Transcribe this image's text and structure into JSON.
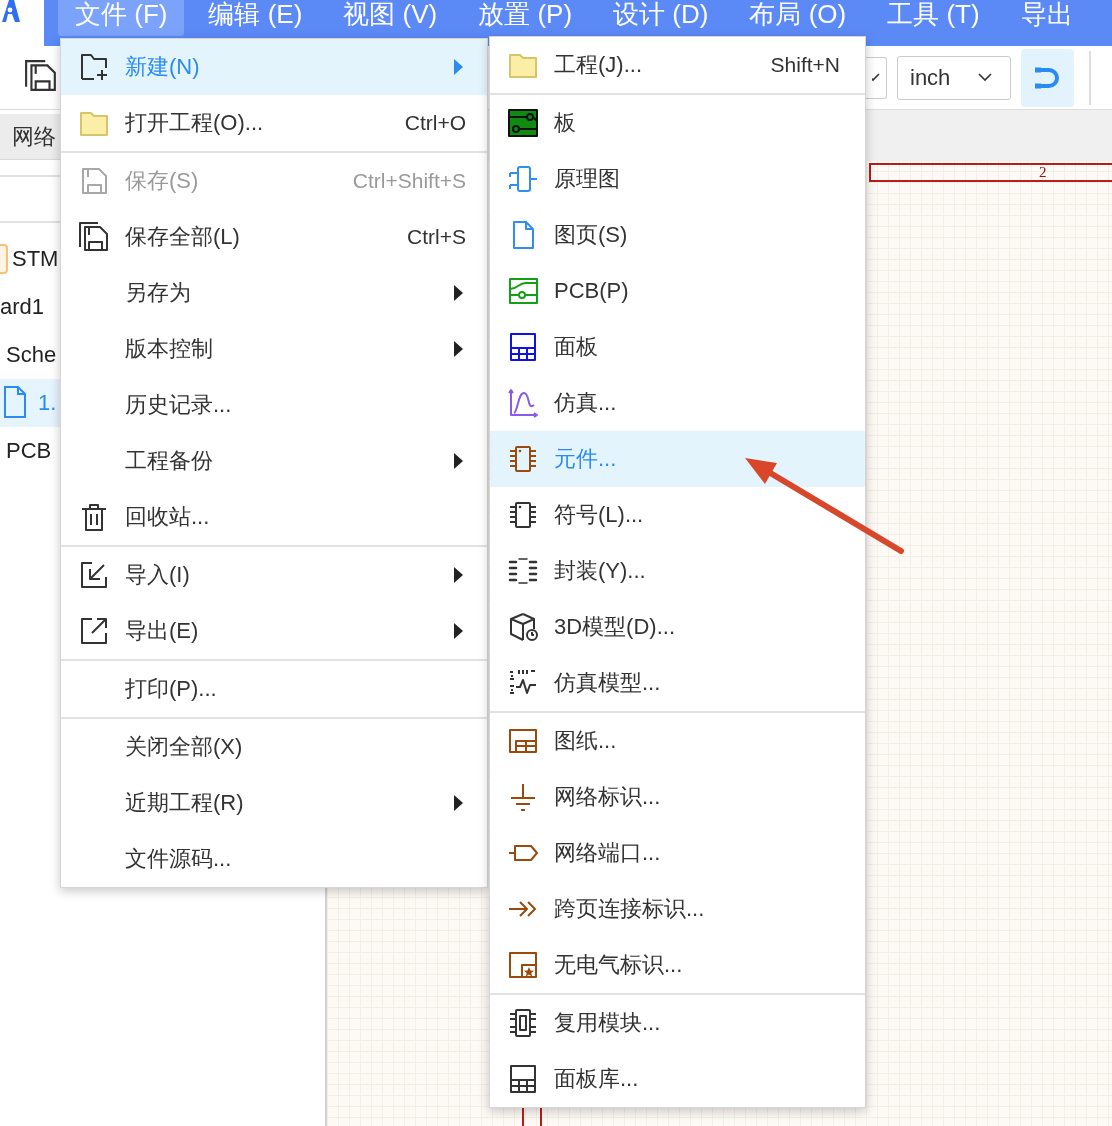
{
  "menubar": {
    "items": [
      {
        "label": "文件 (F)",
        "selected": true
      },
      {
        "label": "编辑 (E)",
        "selected": false
      },
      {
        "label": "视图 (V)",
        "selected": false
      },
      {
        "label": "放置 (P)",
        "selected": false
      },
      {
        "label": "设计 (D)",
        "selected": false
      },
      {
        "label": "布局 (O)",
        "selected": false
      },
      {
        "label": "工具 (T)",
        "selected": false
      },
      {
        "label": "导出",
        "selected": false
      }
    ]
  },
  "toolbar": {
    "unit_select": {
      "value": "inch"
    },
    "snap_button": {
      "selected": true
    }
  },
  "left_panel": {
    "tab": "网络",
    "tree": [
      {
        "label": "STM",
        "selected": false
      },
      {
        "label": "ard1",
        "selected": false
      },
      {
        "label": "Sche",
        "selected": false
      },
      {
        "label": "1.",
        "selected": true
      },
      {
        "label": "PCB",
        "selected": false
      }
    ]
  },
  "canvas": {
    "frame_labels": [
      "2"
    ]
  },
  "file_menu": {
    "groups": [
      [
        {
          "label": "新建(N)",
          "submenu": true,
          "selected": true,
          "disabled": false
        },
        {
          "label": "打开工程(O)...",
          "shortcut": "Ctrl+O",
          "submenu": false,
          "selected": false,
          "disabled": false
        }
      ],
      [
        {
          "label": "保存(S)",
          "shortcut": "Ctrl+Shift+S",
          "submenu": false,
          "selected": false,
          "disabled": true
        },
        {
          "label": "保存全部(L)",
          "shortcut": "Ctrl+S",
          "submenu": false,
          "selected": false,
          "disabled": false
        },
        {
          "label": "另存为",
          "submenu": true,
          "selected": false,
          "disabled": false
        },
        {
          "label": "版本控制",
          "submenu": true,
          "selected": false,
          "disabled": false
        },
        {
          "label": "历史记录...",
          "submenu": false,
          "selected": false,
          "disabled": false
        },
        {
          "label": "工程备份",
          "submenu": true,
          "selected": false,
          "disabled": false
        },
        {
          "label": "回收站...",
          "submenu": false,
          "selected": false,
          "disabled": false
        }
      ],
      [
        {
          "label": "导入(I)",
          "submenu": true,
          "selected": false,
          "disabled": false
        },
        {
          "label": "导出(E)",
          "submenu": true,
          "selected": false,
          "disabled": false
        }
      ],
      [
        {
          "label": "打印(P)...",
          "submenu": false,
          "selected": false,
          "disabled": false
        }
      ],
      [
        {
          "label": "关闭全部(X)",
          "submenu": false,
          "selected": false,
          "disabled": false
        },
        {
          "label": "近期工程(R)",
          "submenu": true,
          "selected": false,
          "disabled": false
        },
        {
          "label": "文件源码...",
          "submenu": false,
          "selected": false,
          "disabled": false
        }
      ]
    ]
  },
  "new_submenu": {
    "groups": [
      [
        {
          "label": "工程(J)...",
          "shortcut": "Shift+N",
          "selected": false
        }
      ],
      [
        {
          "label": "板",
          "selected": false
        },
        {
          "label": "原理图",
          "selected": false
        },
        {
          "label": "图页(S)",
          "selected": false
        },
        {
          "label": "PCB(P)",
          "selected": false
        },
        {
          "label": "面板",
          "selected": false
        },
        {
          "label": "仿真...",
          "selected": false
        },
        {
          "label": "元件...",
          "selected": true
        },
        {
          "label": "符号(L)...",
          "selected": false
        },
        {
          "label": "封装(Y)...",
          "selected": false
        },
        {
          "label": "3D模型(D)...",
          "selected": false
        },
        {
          "label": "仿真模型...",
          "selected": false
        }
      ],
      [
        {
          "label": "图纸...",
          "selected": false
        },
        {
          "label": "网络标识...",
          "selected": false
        },
        {
          "label": "网络端口...",
          "selected": false
        },
        {
          "label": "跨页连接标识...",
          "selected": false
        },
        {
          "label": "无电气标识...",
          "selected": false
        }
      ],
      [
        {
          "label": "复用模块...",
          "selected": false
        },
        {
          "label": "面板库...",
          "selected": false
        }
      ]
    ]
  }
}
